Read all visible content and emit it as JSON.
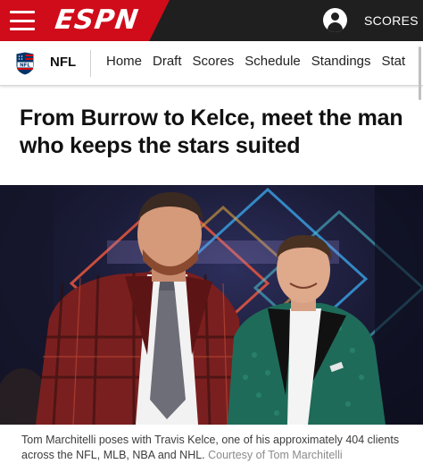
{
  "header": {
    "logo_text": "ESPN",
    "scores_label": "SCORES",
    "brand_color": "#d00c1a"
  },
  "subnav": {
    "league": "NFL",
    "items": [
      {
        "label": "Home"
      },
      {
        "label": "Draft"
      },
      {
        "label": "Scores"
      },
      {
        "label": "Schedule"
      },
      {
        "label": "Standings"
      },
      {
        "label": "Stat"
      }
    ]
  },
  "article": {
    "headline": "From Burrow to Kelce, meet the man who keeps the stars suited",
    "caption": "Tom Marchitelli poses with Travis Kelce, one of his approximately 404 clients across the NFL, MLB, NBA and NHL.",
    "credit": "Courtesy of Tom Marchitelli"
  },
  "icons": {
    "menu": "hamburger-icon",
    "account": "user-icon",
    "league": "nfl-shield-icon"
  }
}
